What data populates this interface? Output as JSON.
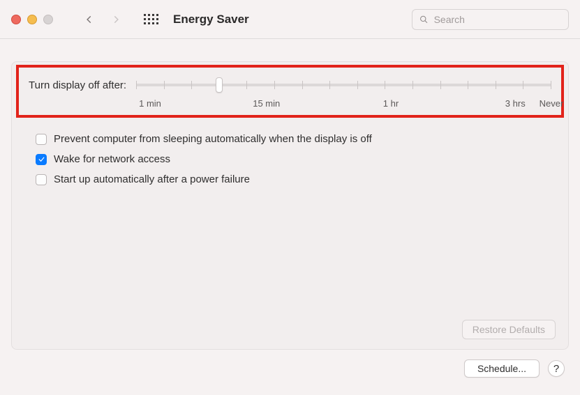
{
  "header": {
    "title": "Energy Saver",
    "search_placeholder": "Search"
  },
  "slider": {
    "label": "Turn display off after:",
    "ticks": {
      "t0": "1 min",
      "t1": "15 min",
      "t2": "1 hr",
      "t3": "3 hrs",
      "t4": "Never"
    },
    "thumb_position_pct": 20
  },
  "options": {
    "prevent_sleep": {
      "label": "Prevent computer from sleeping automatically when the display is off",
      "checked": false
    },
    "wake_network": {
      "label": "Wake for network access",
      "checked": true
    },
    "auto_start": {
      "label": "Start up automatically after a power failure",
      "checked": false
    }
  },
  "buttons": {
    "restore_defaults": "Restore Defaults",
    "schedule": "Schedule...",
    "help": "?"
  }
}
